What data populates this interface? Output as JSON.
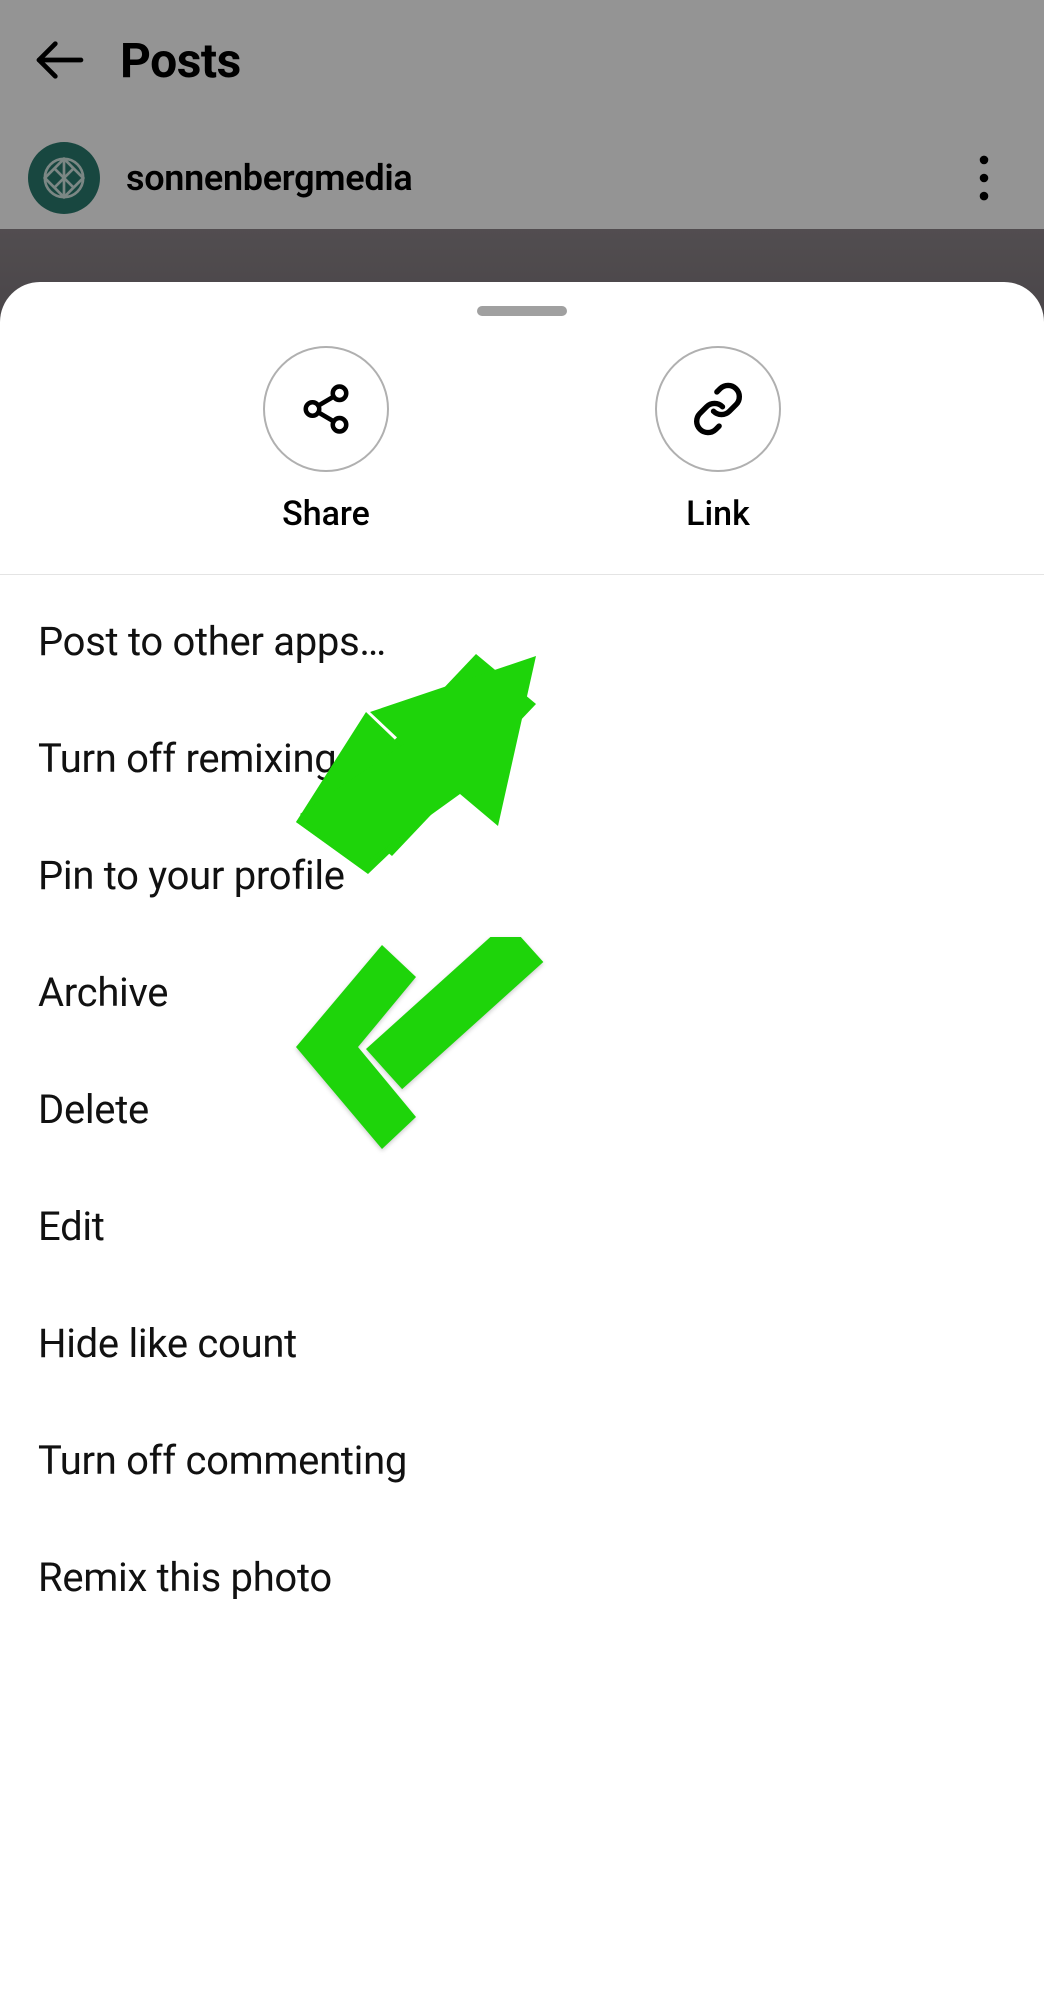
{
  "header": {
    "title": "Posts"
  },
  "post": {
    "username": "sonnenbergmedia"
  },
  "sheet": {
    "actions": {
      "share": "Share",
      "link": "Link"
    },
    "menu": [
      "Post to other apps…",
      "Turn off remixing",
      "Pin to your profile",
      "Archive",
      "Delete",
      "Edit",
      "Hide like count",
      "Turn off commenting",
      "Remix this photo"
    ]
  },
  "annotation": {
    "color": "#1ed40a"
  }
}
